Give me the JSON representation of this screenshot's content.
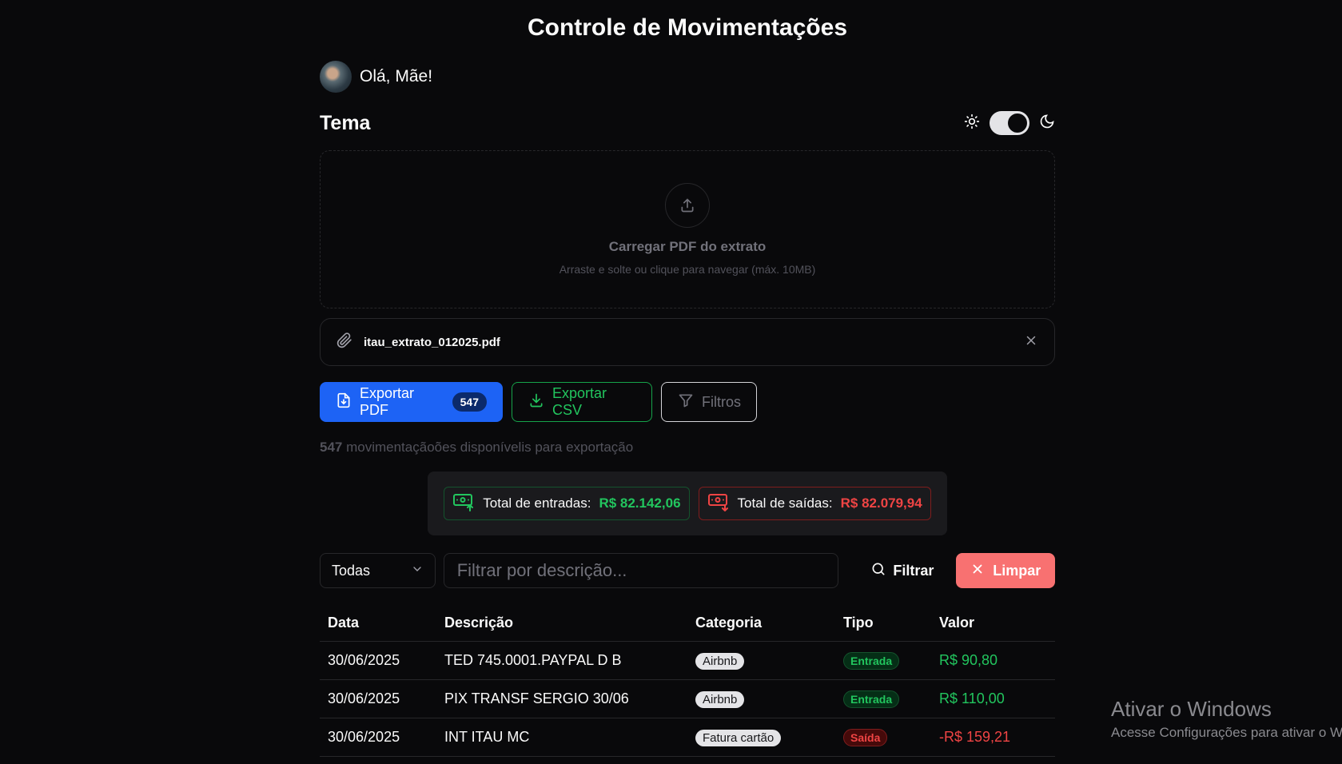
{
  "header": {
    "title": "Controle de Movimentações"
  },
  "user": {
    "greeting": "Olá, Mãe!"
  },
  "theme": {
    "label": "Tema",
    "mode": "dark"
  },
  "upload": {
    "title": "Carregar PDF do extrato",
    "subtitle": "Arraste e solte ou clique para navegar (máx. 10MB)"
  },
  "file": {
    "name": "itau_extrato_012025.pdf"
  },
  "actions": {
    "export_pdf": "Exportar PDF",
    "count": "547",
    "export_csv": "Exportar CSV",
    "filters": "Filtros"
  },
  "availability": {
    "count": "547",
    "text": " movimentaçãoões disponívelis para exportação"
  },
  "totals": {
    "in_label": "Total de entradas:",
    "in_value": "R$ 82.142,06",
    "out_label": "Total de saídas:",
    "out_value": "R$ 82.079,94"
  },
  "filter_bar": {
    "select_value": "Todas",
    "search_placeholder": "Filtrar por descrição...",
    "filter_button": "Filtrar",
    "clear_button": "Limpar"
  },
  "table": {
    "headers": {
      "date": "Data",
      "desc": "Descrição",
      "cat": "Categoria",
      "type": "Tipo",
      "value": "Valor"
    },
    "rows": [
      {
        "date": "30/06/2025",
        "desc": "TED 745.0001.PAYPAL D B",
        "cat": "Airbnb",
        "type": "Entrada",
        "value": "R$ 90,80"
      },
      {
        "date": "30/06/2025",
        "desc": "PIX TRANSF SERGIO 30/06",
        "cat": "Airbnb",
        "type": "Entrada",
        "value": "R$ 110,00"
      },
      {
        "date": "30/06/2025",
        "desc": "INT ITAU MC",
        "cat": "Fatura cartão",
        "type": "Saída",
        "value": "-R$ 159,21"
      }
    ]
  },
  "watermark": {
    "line1": "Ativar o Windows",
    "line2": "Acesse Configurações para ativar o Windows."
  },
  "colors": {
    "background": "#09090b",
    "primary": "#1d63f5",
    "positive": "#22c55e",
    "negative": "#ef4444",
    "clear": "#f87171"
  }
}
